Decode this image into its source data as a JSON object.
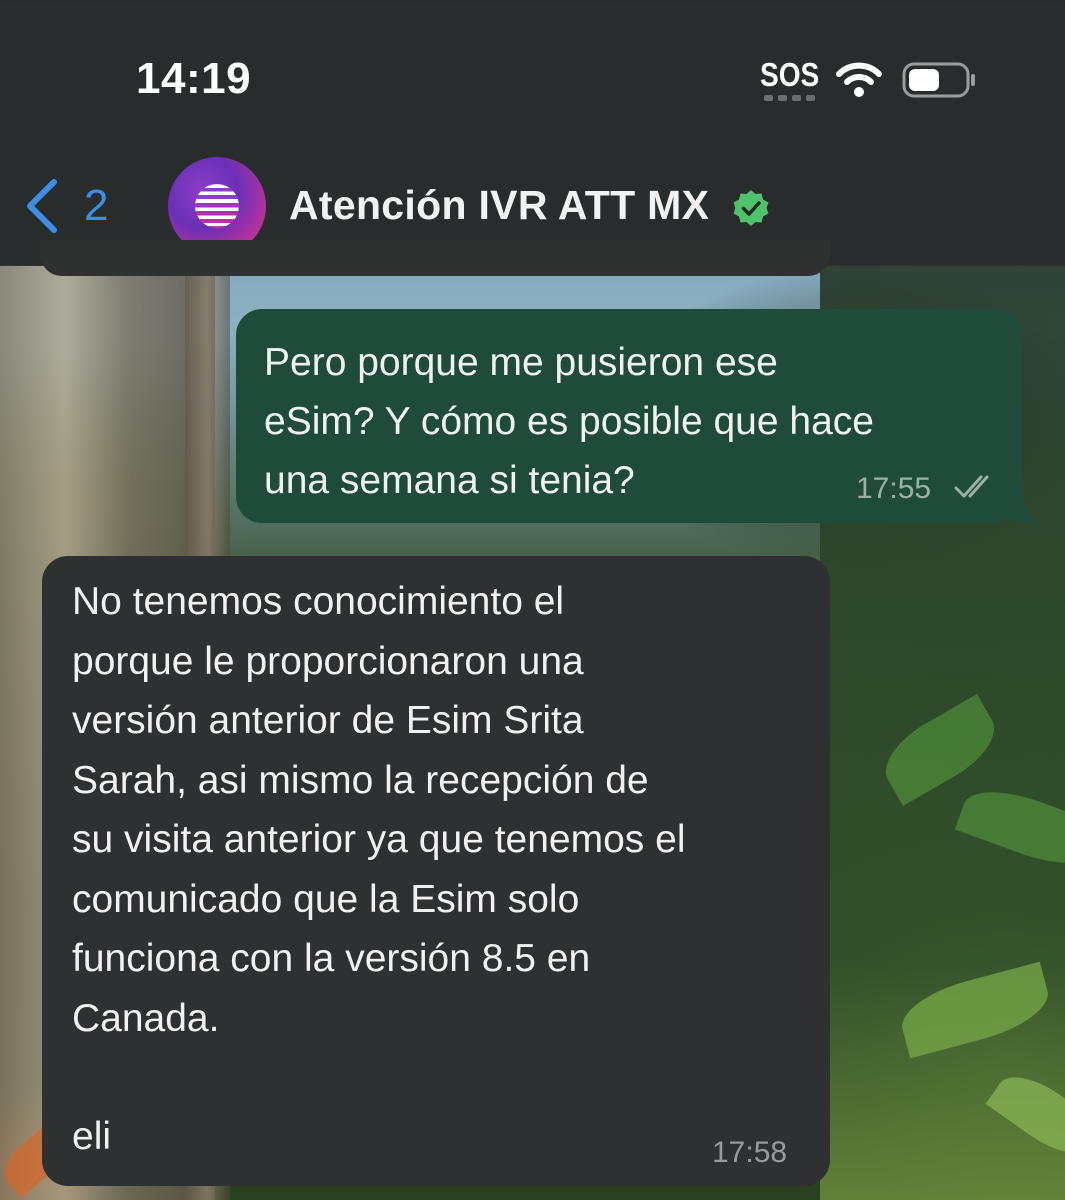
{
  "status_bar": {
    "time": "14:19",
    "sos": "SOS",
    "icons": [
      "sos-indicator",
      "wifi-icon",
      "battery-icon"
    ]
  },
  "header": {
    "back_count": "2",
    "contact_name": "Atención IVR ATT MX",
    "verified": true,
    "avatar": "att-globe-logo",
    "accent_color": "#3d8fe3"
  },
  "messages": [
    {
      "direction": "outgoing",
      "text": "Pero porque me pusieron ese\neSim? Y cómo es posible que hace\nuna semana si tenia?",
      "time": "17:55",
      "status": "read-double-check",
      "bubble_color": "#1e4b3a"
    },
    {
      "direction": "incoming",
      "text": "No tenemos conocimiento el\nporque le proporcionaron una\nversión anterior de Esim Srita\nSarah, asi mismo la recepción de\nsu visita anterior ya que tenemos el\ncomunicado que la Esim solo\nfunciona con la versión 8.5 en\nCanada.",
      "signature": "eli",
      "time": "17:58",
      "bubble_color": "#2f3031"
    }
  ],
  "colors": {
    "header_bg": "#262828",
    "verified_badge": "#4fc36b",
    "text": "#f1f1f1"
  }
}
